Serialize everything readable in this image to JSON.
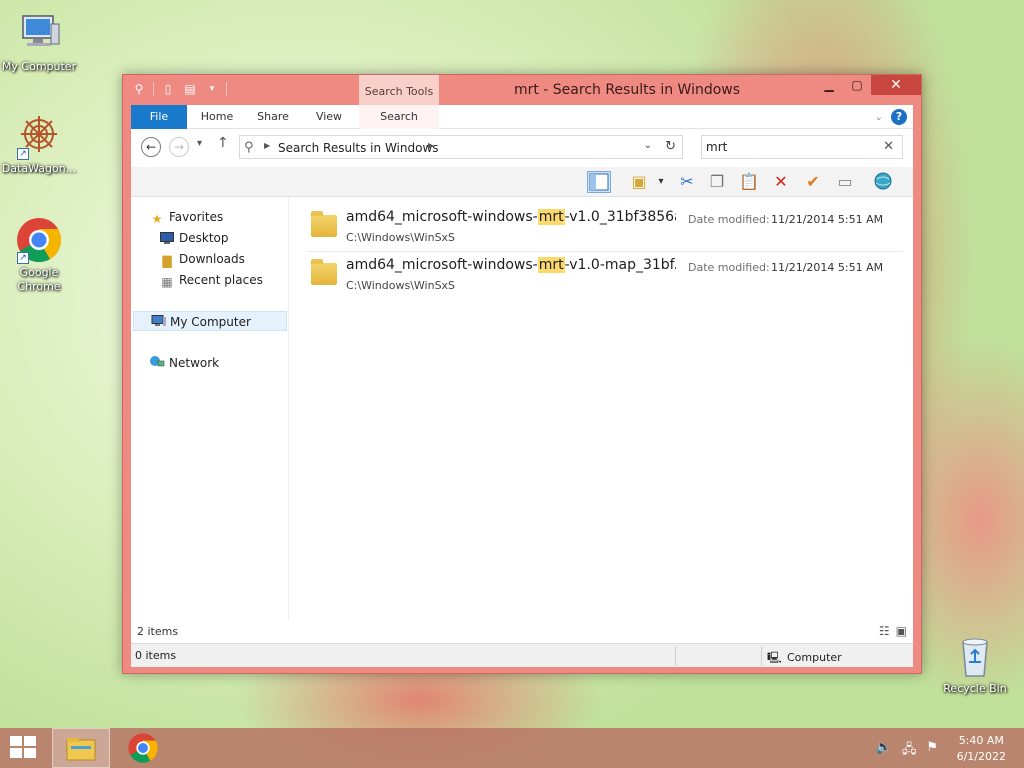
{
  "desktop": {
    "icons": [
      {
        "label": "My Computer"
      },
      {
        "label": "DataWagon..."
      },
      {
        "label": "Google Chrome"
      },
      {
        "label": "Recycle Bin"
      }
    ]
  },
  "window": {
    "title": "mrt - Search Results in Windows",
    "context_tab": "Search Tools",
    "ribbon_tabs": [
      "File",
      "Home",
      "Share",
      "View",
      "Search"
    ],
    "help": "?",
    "address_crumb": "Search Results in Windows",
    "search_value": "mrt",
    "nav_pane": {
      "favorites": "Favorites",
      "desktop": "Desktop",
      "downloads": "Downloads",
      "recent": "Recent places",
      "computer": "My Computer",
      "network": "Network"
    },
    "results": [
      {
        "name_prefix": "amd64_microsoft-windows-",
        "name_match": "mrt",
        "name_suffix": "-v1.0_31bf3856a...",
        "path": "C:\\Windows\\WinSxS",
        "date_label": "Date modified:",
        "date_value": "11/21/2014 5:51 AM"
      },
      {
        "name_prefix": "amd64_microsoft-windows-",
        "name_match": "mrt",
        "name_suffix": "-v1.0-map_31bf...",
        "path": "C:\\Windows\\WinSxS",
        "date_label": "Date modified:",
        "date_value": "11/21/2014 5:51 AM"
      }
    ],
    "item_count": "2 items",
    "selection_count": "0 items",
    "zone": "Computer"
  },
  "taskbar": {
    "time": "5:40 AM",
    "date": "6/1/2022"
  },
  "colors": {
    "window_frame": "#ee8a82",
    "file_tab": "#1979ca",
    "highlight": "#fbd96b",
    "close_button": "#c7463d"
  }
}
